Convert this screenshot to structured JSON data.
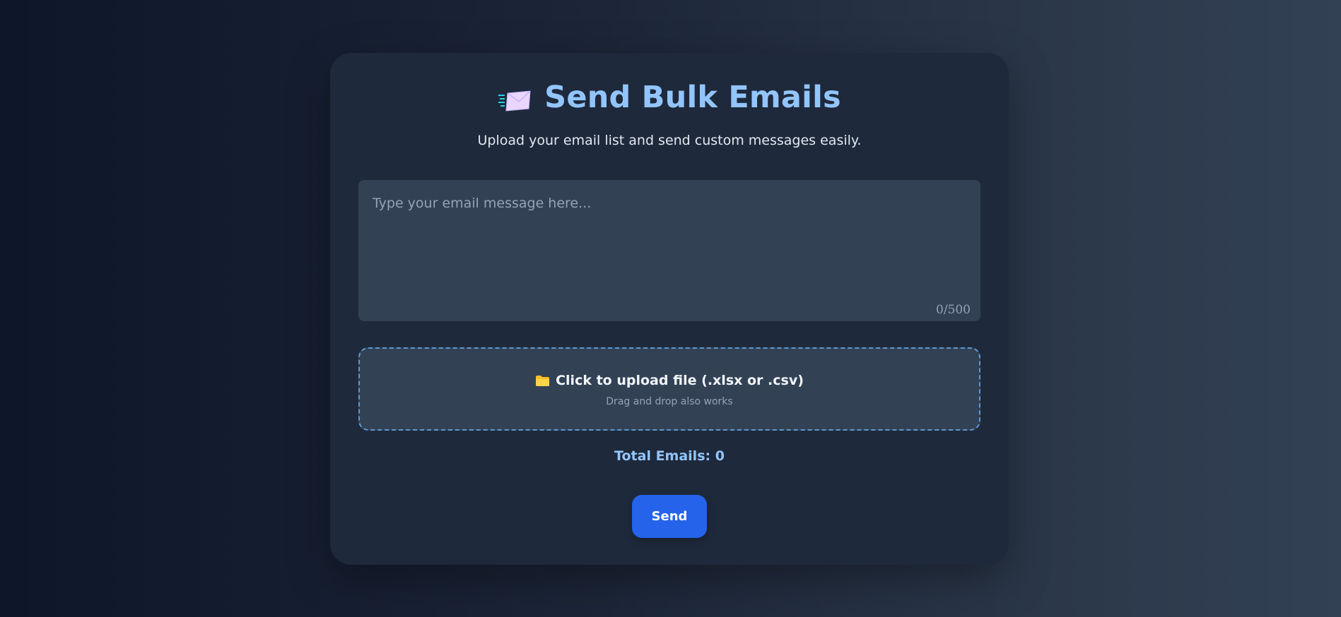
{
  "header": {
    "title": "Send Bulk Emails",
    "subtitle": "Upload your email list and send custom messages easily.",
    "icon": "flying-envelope-icon"
  },
  "message": {
    "placeholder": "Type your email message here...",
    "value": "",
    "char_count": "0/500"
  },
  "upload": {
    "icon": "folder-icon",
    "label": "Click to upload file (.xlsx or .csv)",
    "hint": "Drag and drop also works"
  },
  "summary": {
    "total_emails": "Total Emails: 0"
  },
  "actions": {
    "send_label": "Send"
  },
  "colors": {
    "accent": "#93c5fd",
    "button": "#2563eb",
    "card": "#1e293b",
    "input": "#334155",
    "dashed_border": "#5b9bd5"
  }
}
